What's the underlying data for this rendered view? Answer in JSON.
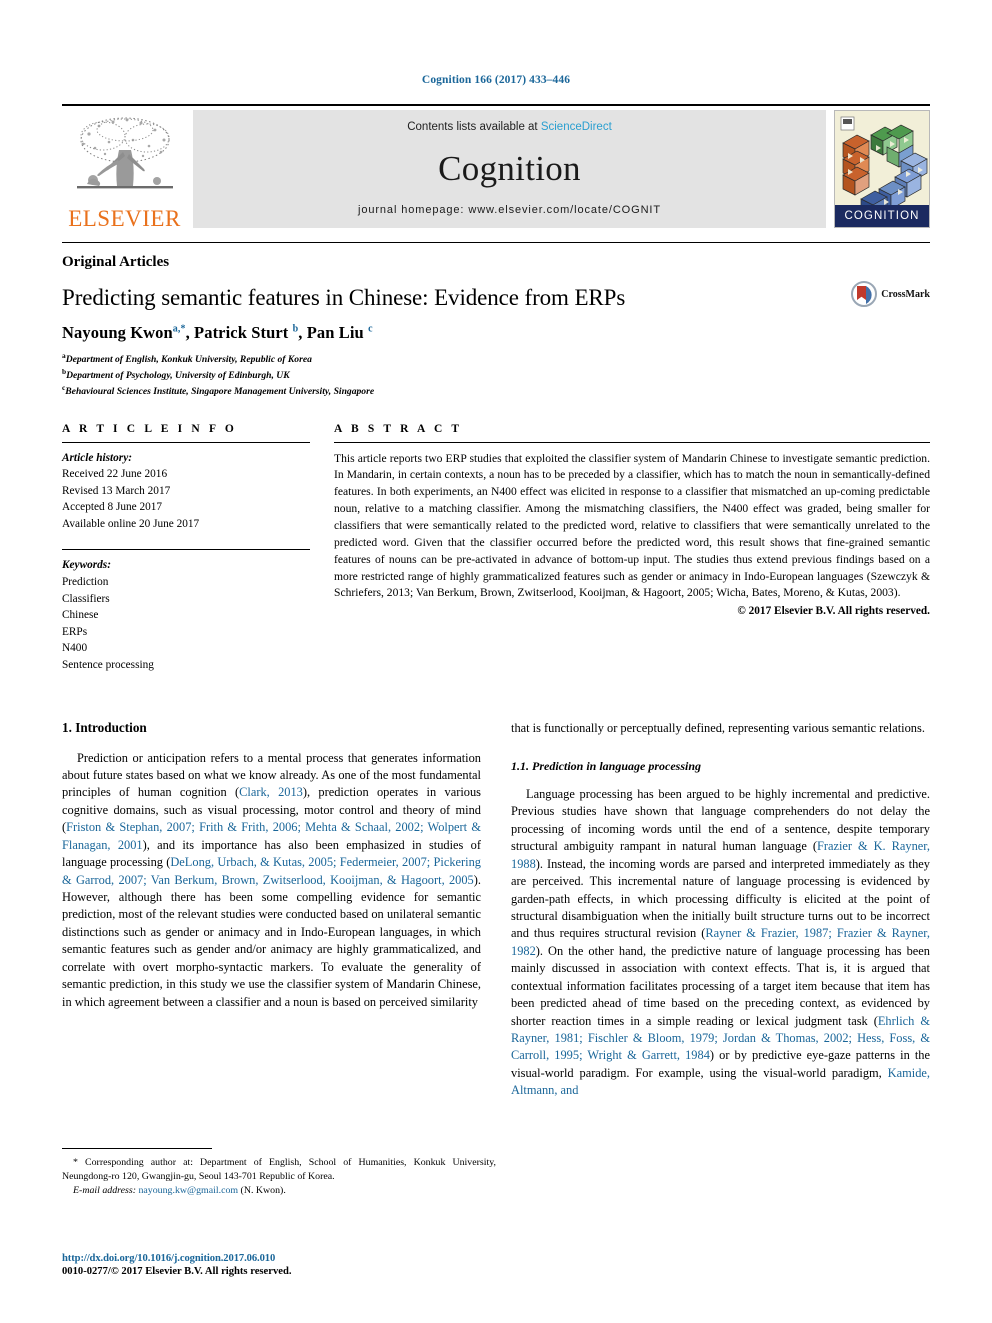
{
  "running_head": "Cognition 166 (2017) 433–446",
  "masthead": {
    "publisher_name": "ELSEVIER",
    "contents_prefix": "Contents lists available at ",
    "contents_link": "ScienceDirect",
    "journal_name": "Cognition",
    "homepage": "journal homepage: www.elsevier.com/locate/COGNIT",
    "cover_label": "COGNITION"
  },
  "article": {
    "type": "Original Articles",
    "title": "Predicting semantic features in Chinese: Evidence from ERPs",
    "crossmark_label": "CrossMark",
    "authors": [
      {
        "name": "Nayoung Kwon",
        "marks": "a,*"
      },
      {
        "name": "Patrick Sturt",
        "marks": "b"
      },
      {
        "name": "Pan Liu",
        "marks": "c"
      }
    ],
    "affiliations": [
      {
        "mark": "a",
        "text": "Department of English, Konkuk University, Republic of Korea"
      },
      {
        "mark": "b",
        "text": "Department of Psychology, University of Edinburgh, UK"
      },
      {
        "mark": "c",
        "text": "Behavioural Sciences Institute, Singapore Management University, Singapore"
      }
    ]
  },
  "article_info": {
    "heading": "A R T I C L E   I N F O",
    "history_label": "Article history:",
    "history": [
      "Received 22 June 2016",
      "Revised 13 March 2017",
      "Accepted 8 June 2017",
      "Available online 20 June 2017"
    ],
    "keywords_label": "Keywords:",
    "keywords": [
      "Prediction",
      "Classifiers",
      "Chinese",
      "ERPs",
      "N400",
      "Sentence processing"
    ]
  },
  "abstract": {
    "heading": "A B S T R A C T",
    "text": "This article reports two ERP studies that exploited the classifier system of Mandarin Chinese to investigate semantic prediction. In Mandarin, in certain contexts, a noun has to be preceded by a classifier, which has to match the noun in semantically-defined features. In both experiments, an N400 effect was elicited in response to a classifier that mismatched an up-coming predictable noun, relative to a matching classifier. Among the mismatching classifiers, the N400 effect was graded, being smaller for classifiers that were semantically related to the predicted word, relative to classifiers that were semantically unrelated to the predicted word. Given that the classifier occurred before the predicted word, this result shows that fine-grained semantic features of nouns can be pre-activated in advance of bottom-up input. The studies thus extend previous findings based on a more restricted range of highly grammaticalized features such as gender or animacy in Indo-European languages (Szewczyk & Schriefers, 2013; Van Berkum, Brown, Zwitserlood, Kooijman, & Hagoort, 2005; Wicha, Bates, Moreno, & Kutas, 2003).",
    "copyright": "© 2017 Elsevier B.V. All rights reserved."
  },
  "body": {
    "section1_heading": "1. Introduction",
    "left_p1_a": "Prediction or anticipation refers to a mental process that generates information about future states based on what we know already. As one of the most fundamental principles of human cognition (",
    "left_p1_cit1": "Clark, 2013",
    "left_p1_b": "), prediction operates in various cognitive domains, such as visual processing, motor control and theory of mind (",
    "left_p1_cit2": "Friston & Stephan, 2007; Frith & Frith, 2006; Mehta & Schaal, 2002; Wolpert & Flanagan, 2001",
    "left_p1_c": "), and its importance has also been emphasized in studies of language processing (",
    "left_p1_cit3": "DeLong, Urbach, & Kutas, 2005; Federmeier, 2007; Pickering & Garrod, 2007; Van Berkum, Brown, Zwitserlood, Kooijman, & Hagoort, 2005",
    "left_p1_d": "). However, although there has been some compelling evidence for semantic prediction, most of the relevant studies were conducted based on unilateral semantic distinctions such as gender or animacy and in Indo-European languages, in which semantic features such as gender and/or animacy are highly grammaticalized, and correlate with overt morpho-syntactic markers. To evaluate the generality of semantic prediction, in this study we use the classifier system of Mandarin Chinese, in which agreement between a classifier and a noun is based on perceived similarity",
    "right_p0": "that is functionally or perceptually defined, representing various semantic relations.",
    "subsection11_heading": "1.1. Prediction in language processing",
    "right_p1_a": "Language processing has been argued to be highly incremental and predictive. Previous studies have shown that language comprehenders do not delay the processing of incoming words until the end of a sentence, despite temporary structural ambiguity rampant in natural human language (",
    "right_p1_cit1": "Frazier & K. Rayner, 1988",
    "right_p1_b": "). Instead, the incoming words are parsed and interpreted immediately as they are perceived. This incremental nature of language processing is evidenced by garden-path effects, in which processing difficulty is elicited at the point of structural disambiguation when the initially built structure turns out to be incorrect and thus requires structural revision (",
    "right_p1_cit2": "Rayner & Frazier, 1987; Frazier & Rayner, 1982",
    "right_p1_c": "). On the other hand, the predictive nature of language processing has been mainly discussed in association with context effects. That is, it is argued that contextual information facilitates processing of a target item because that item has been predicted ahead of time based on the preceding context, as evidenced by shorter reaction times in a simple reading or lexical judgment task (",
    "right_p1_cit3": "Ehrlich & Rayner, 1981; Fischler & Bloom, 1979; Jordan & Thomas, 2002; Hess, Foss, & Carroll, 1995; Wright & Garrett, 1984",
    "right_p1_d": ") or by predictive eye-gaze patterns in the visual-world paradigm. For example, using the visual-world paradigm, ",
    "right_p1_cit4": "Kamide, Altmann, and"
  },
  "footnotes": {
    "corresponding_mark": "*",
    "corresponding": "Corresponding author at: Department of English, School of Humanities, Konkuk University, Neungdong-ro 120, Gwangjin-gu, Seoul 143-701 Republic of Korea.",
    "email_label": "E-mail address:",
    "email": "nayoung.kw@gmail.com",
    "email_suffix": "(N. Kwon).",
    "doi": "http://dx.doi.org/10.1016/j.cognition.2017.06.010",
    "issn": "0010-0277/© 2017 Elsevier B.V. All rights reserved."
  },
  "colors": {
    "link_blue": "#1a6699",
    "sciencedirect_blue": "#2a9fd0",
    "elsevier_orange": "#E9711C",
    "masthead_gray": "#e3e3e3",
    "cover_navy": "#1b2a60"
  }
}
